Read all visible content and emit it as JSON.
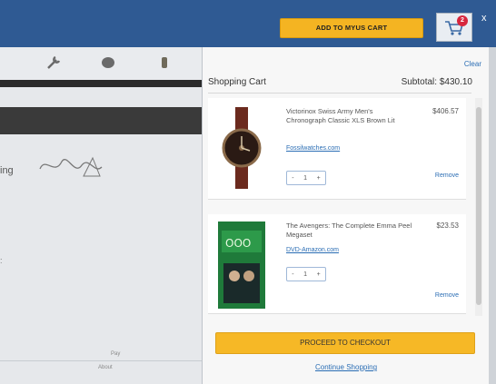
{
  "header": {
    "add_to_cart_label": "ADD TO MYUS CART",
    "cart_badge_count": "2",
    "close_label": "x"
  },
  "background": {
    "sign_text": "ing",
    "footer_line1": "Pay",
    "footer_line2": "About"
  },
  "cart": {
    "clear_label": "Clear",
    "title": "Shopping Cart",
    "subtotal_label": "Subtotal:",
    "subtotal_value": "$430.10",
    "items": [
      {
        "title": "Victorinox Swiss Army Men's Chronograph Classic XLS Brown Lit",
        "seller": "Fossilwatches.com",
        "price": "$406.57",
        "qty": "1",
        "remove_label": "Remove"
      },
      {
        "title": "The Avengers: The Complete Emma Peel Megaset",
        "seller": "DVD-Amazon.com",
        "price": "$23.53",
        "qty": "1",
        "remove_label": "Remove"
      }
    ],
    "qty_minus": "-",
    "qty_plus": "+",
    "checkout_label": "PROCEED TO CHECKOUT",
    "continue_label": "Continue Shopping"
  },
  "colors": {
    "topbar": "#2f5a93",
    "accent": "#f4b422",
    "link": "#2a6db4",
    "badge": "#d7263d"
  }
}
